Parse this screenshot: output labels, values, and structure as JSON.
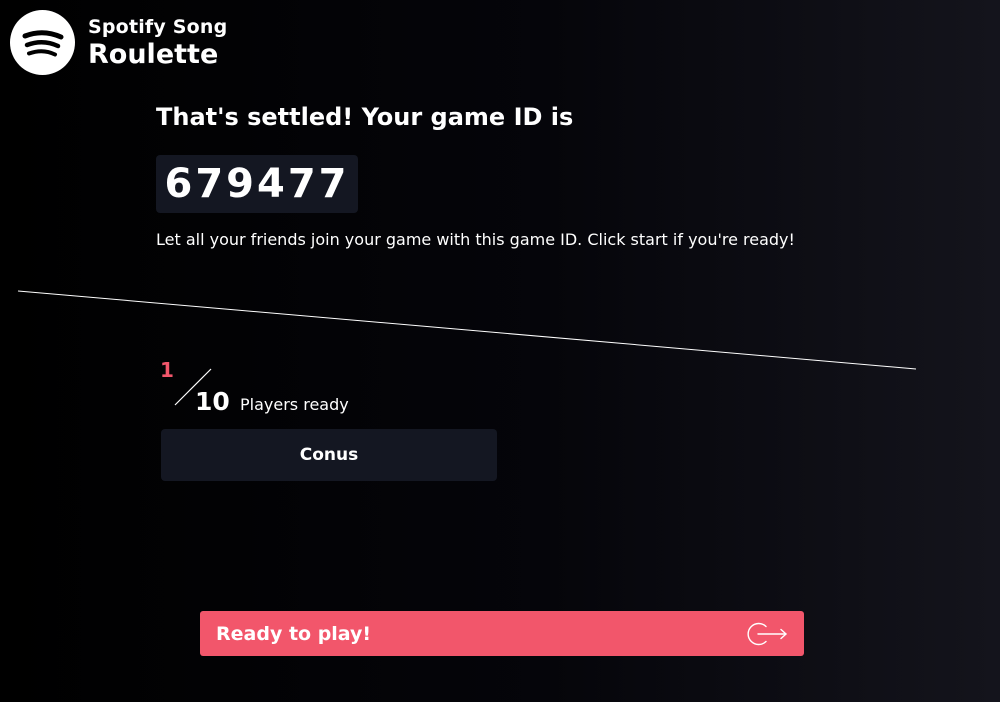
{
  "brand": {
    "line1": "Spotify Song",
    "line2": "Roulette"
  },
  "headline": "That's settled! Your game ID is",
  "game_id": "679477",
  "instructions": "Let all your friends join your game with this game ID. Click start if you're ready!",
  "players": {
    "ready_count": "1",
    "total_count": "10",
    "label": "Players ready",
    "list": [
      "Conus"
    ]
  },
  "ready_button": {
    "label": "Ready to play!"
  },
  "colors": {
    "accent": "#f2566b",
    "card": "#141722",
    "background": "#000000",
    "text": "#ffffff"
  },
  "icons": {
    "logo": "spotify-logo-icon",
    "button": "exit-arrow-icon"
  }
}
